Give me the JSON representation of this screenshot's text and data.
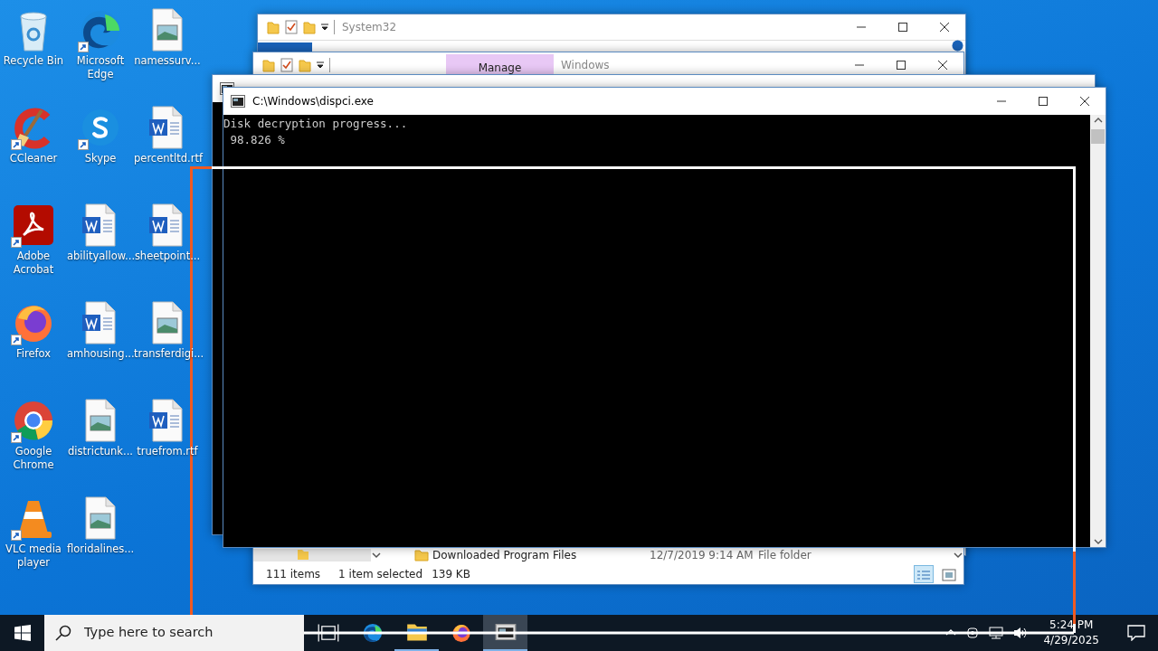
{
  "desktop_icons": [
    {
      "label": "Recycle Bin",
      "kind": "recycle",
      "shortcut": false
    },
    {
      "label": "CCleaner",
      "kind": "ccleaner",
      "shortcut": true
    },
    {
      "label": "Adobe Acrobat",
      "kind": "acrobat",
      "shortcut": true
    },
    {
      "label": "Firefox",
      "kind": "firefox",
      "shortcut": true
    },
    {
      "label": "Google Chrome",
      "kind": "chrome",
      "shortcut": true
    },
    {
      "label": "VLC media player",
      "kind": "vlc",
      "shortcut": true
    },
    {
      "label": "Microsoft Edge",
      "kind": "edge",
      "shortcut": true
    },
    {
      "label": "Skype",
      "kind": "skype",
      "shortcut": true
    },
    {
      "label": "abilityallow...",
      "kind": "word",
      "shortcut": false
    },
    {
      "label": "amhousing...",
      "kind": "word",
      "shortcut": false
    },
    {
      "label": "districtunk...",
      "kind": "image",
      "shortcut": false
    },
    {
      "label": "floridalines...",
      "kind": "image",
      "shortcut": false
    },
    {
      "label": "namessurv...",
      "kind": "image",
      "shortcut": false
    },
    {
      "label": "percentltd.rtf",
      "kind": "word",
      "shortcut": false
    },
    {
      "label": "sheetpoint...",
      "kind": "word",
      "shortcut": false
    },
    {
      "label": "transferdigi...",
      "kind": "image",
      "shortcut": false
    },
    {
      "label": "truefrom.rtf",
      "kind": "word",
      "shortcut": false
    }
  ],
  "windows": [
    {
      "kind": "explorer",
      "title": "System32"
    },
    {
      "kind": "explorer",
      "title": "Windows",
      "context_tab": "Manage",
      "file_row": {
        "name": "Downloaded Program Files",
        "date": "12/7/2019 9:14 AM",
        "type": "File folder"
      },
      "status_bar": {
        "count": "111 items",
        "selection": "1 item selected",
        "size": "139 KB"
      }
    },
    {
      "kind": "console"
    },
    {
      "kind": "console",
      "title": "C:\\Windows\\dispci.exe",
      "lines": [
        "Disk decryption progress...",
        " 98.826 %"
      ]
    }
  ],
  "taskbar": {
    "search_placeholder": "Type here to search",
    "apps": [
      {
        "kind": "taskview",
        "running": false,
        "selected": false
      },
      {
        "kind": "edge",
        "running": false,
        "selected": false
      },
      {
        "kind": "explorer",
        "running": true,
        "selected": false
      },
      {
        "kind": "firefox",
        "running": false,
        "selected": false
      },
      {
        "kind": "console",
        "running": true,
        "selected": true
      }
    ],
    "time": "5:24 PM",
    "date": "4/29/2025"
  }
}
